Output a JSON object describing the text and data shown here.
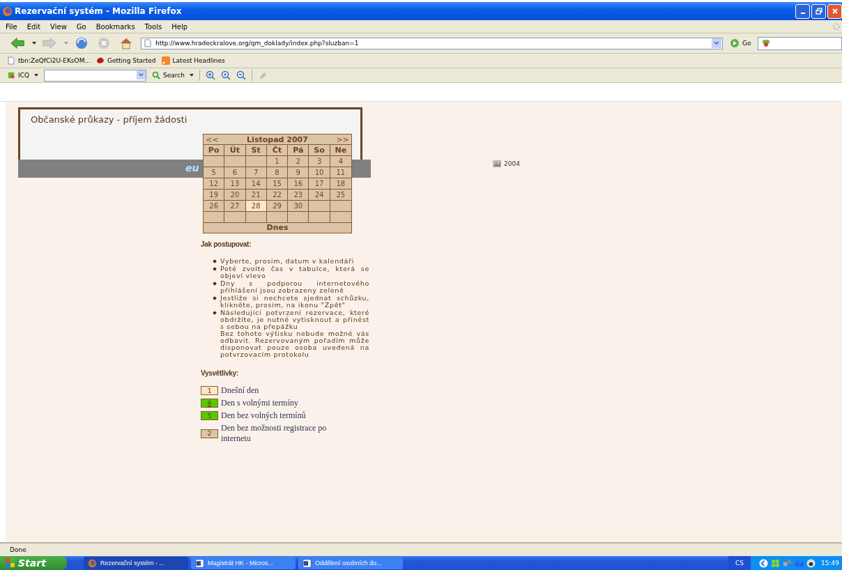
{
  "window": {
    "title": "Rezervační systém - Mozilla Firefox"
  },
  "menu": [
    "File",
    "Edit",
    "View",
    "Go",
    "Bookmarks",
    "Tools",
    "Help"
  ],
  "address": {
    "value": "http://www.hradeckralove.org/qm_doklady/index.php?sluzban=1",
    "go": "Go"
  },
  "bookmarks": [
    "tbn:ZeQfCi2U-EKsOM...",
    "Getting Started",
    "Latest Headlines"
  ],
  "icq_toolbar": {
    "label": "ICQ",
    "search": "Search"
  },
  "page": {
    "heading": "Občanské průkazy - příjem žádosti",
    "footer_logo": "eu",
    "year": "2004",
    "calendar": {
      "prev": "<<",
      "month": "Listopad 2007",
      "next": ">>",
      "weekdays": [
        "Po",
        "Út",
        "St",
        "Čt",
        "Pá",
        "So",
        "Ne"
      ],
      "weeks": [
        [
          {
            "blank": true
          },
          {
            "blank": true
          },
          {
            "blank": true
          },
          {
            "day": "1",
            "today": false
          },
          {
            "day": "2",
            "today": false
          },
          {
            "day": "3",
            "today": false
          },
          {
            "day": "4",
            "today": false
          }
        ],
        [
          {
            "day": "5",
            "today": false
          },
          {
            "day": "6",
            "today": false
          },
          {
            "day": "7",
            "today": false
          },
          {
            "day": "8",
            "today": false
          },
          {
            "day": "9",
            "today": false
          },
          {
            "day": "10",
            "today": false
          },
          {
            "day": "11",
            "today": false
          }
        ],
        [
          {
            "day": "12",
            "today": false
          },
          {
            "day": "13",
            "today": false
          },
          {
            "day": "14",
            "today": false
          },
          {
            "day": "15",
            "today": false
          },
          {
            "day": "16",
            "today": false
          },
          {
            "day": "17",
            "today": false
          },
          {
            "day": "18",
            "today": false
          }
        ],
        [
          {
            "day": "19",
            "today": false
          },
          {
            "day": "20",
            "today": false
          },
          {
            "day": "21",
            "today": false
          },
          {
            "day": "22",
            "today": false
          },
          {
            "day": "23",
            "today": false
          },
          {
            "day": "24",
            "today": false
          },
          {
            "day": "25",
            "today": false
          }
        ],
        [
          {
            "day": "26",
            "today": false
          },
          {
            "day": "27",
            "today": false
          },
          {
            "day": "28",
            "today": true
          },
          {
            "day": "29",
            "today": false
          },
          {
            "day": "30",
            "today": false
          },
          {
            "blank": true
          },
          {
            "blank": true
          }
        ],
        [
          {
            "blank": true
          },
          {
            "blank": true
          },
          {
            "blank": true
          },
          {
            "blank": true
          },
          {
            "blank": true
          },
          {
            "blank": true
          },
          {
            "blank": true
          }
        ]
      ],
      "today_button": "Dnes"
    },
    "instructions_title": "Jak postupovat:",
    "instructions": [
      {
        "text": "Vyberte, prosím, datum v kalendáři"
      },
      {
        "text": "Poté zvolte čas v tabulce, která se objeví vlevo"
      },
      {
        "text": "Dny s podporou internetového přihlášení jsou zobrazeny zeleně"
      },
      {
        "text": "Jestliže si nechcete sjednat schůzku, klikněte, prosím, na ikonu \"Zpět\""
      },
      {
        "text": "Následující potvrzení rezervace, které obdržíte, je nutné vytisknout a přinést s sebou na přepážku",
        "note": "Bez tohoto výtisku nebude možné vás odbavit. Rezervovaným pořadím může disponovat pouze osoba uvedená na potvrzovacím protokolu"
      }
    ],
    "legend_title": "Vysvětlivky:",
    "legend": [
      {
        "kind": "today",
        "sample": "1",
        "label": "Dnešní den"
      },
      {
        "kind": "free",
        "sample": "6",
        "label": "Den s volnými termíny"
      },
      {
        "kind": "full",
        "sample": "5",
        "label": "Den bez volných termínů"
      },
      {
        "kind": "offline",
        "sample": "2",
        "label": "Den bez možnosti registrace po internetu"
      }
    ]
  },
  "status_bar": "Done",
  "taskbar": {
    "start": "Start",
    "tasks": [
      {
        "kind": "firefox",
        "label": "Rezervační systém - ...",
        "selected": true
      },
      {
        "kind": "word",
        "label": "Magistrát HK - Micros...",
        "selected": false
      },
      {
        "kind": "word",
        "label": "Oddělení osobních do...",
        "selected": false
      }
    ],
    "language": "CS",
    "clock": "15:49"
  }
}
